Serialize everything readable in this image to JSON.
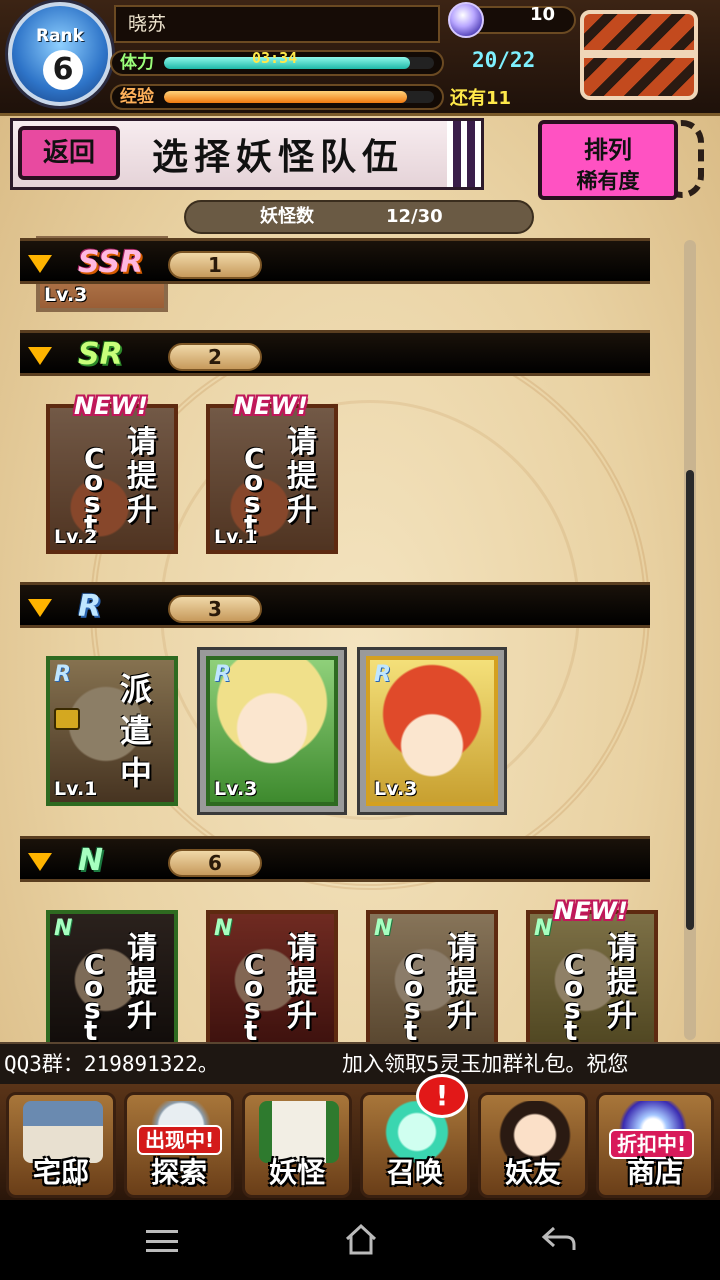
{
  "status": {
    "rank_label": "Rank",
    "rank_value": "6",
    "player_name": "晓苏",
    "stamina_label": "体力",
    "stamina_timer": "03:34",
    "stamina_fill": 0.91,
    "stamina_count": "20/22",
    "exp_label": "经验",
    "exp_fill": 0.9,
    "exp_remaining": "还有11",
    "gems": "10"
  },
  "header": {
    "back_label": "返回",
    "title": "选择妖怪队伍",
    "sort_label": "排列",
    "sort_mode": "稀有度"
  },
  "monster_count": {
    "label": "妖怪数",
    "value": "12/30"
  },
  "sections": [
    {
      "rarity": "SSR",
      "count": "1"
    },
    {
      "rarity": "SR",
      "count": "2"
    },
    {
      "rarity": "R",
      "count": "3"
    },
    {
      "rarity": "N",
      "count": "6"
    }
  ],
  "cards": {
    "ssr_partial_lv": "Lv.3",
    "sr": [
      {
        "lv": "Lv.2",
        "badge": "NEW!",
        "line1": "请提升",
        "line2": "Cost"
      },
      {
        "lv": "Lv.1",
        "badge": "NEW!",
        "line1": "请提升",
        "line2": "Cost"
      }
    ],
    "r": [
      {
        "lv": "Lv.1",
        "rarity": "R",
        "status": "派遣中"
      },
      {
        "lv": "Lv.3",
        "rarity": "R"
      },
      {
        "lv": "Lv.3",
        "rarity": "R"
      }
    ],
    "n": [
      {
        "rarity": "N",
        "line1": "请提升",
        "line2": "Cost"
      },
      {
        "rarity": "N",
        "line1": "请提升",
        "line2": "Cost"
      },
      {
        "rarity": "N",
        "line1": "请提升",
        "line2": "Cost"
      },
      {
        "rarity": "N",
        "badge": "NEW!",
        "line1": "请提升",
        "line2": "Cost"
      }
    ]
  },
  "ticker": {
    "part1": "QQ3群：219891322。",
    "part2": "加入领取5灵玉加群礼包。祝您"
  },
  "nav": {
    "home": "宅邸",
    "explore": "探索",
    "explore_badge": "出现中!",
    "monster": "妖怪",
    "summon": "召唤",
    "summon_alert": "!",
    "friends": "妖友",
    "shop": "商店",
    "shop_badge": "折扣中!"
  },
  "colors": {
    "accent_pink": "#ff52c2",
    "stamina_bar": "#35d9c6",
    "exp_bar": "#ff9a1e",
    "rarity_gold": "#ffb400"
  }
}
